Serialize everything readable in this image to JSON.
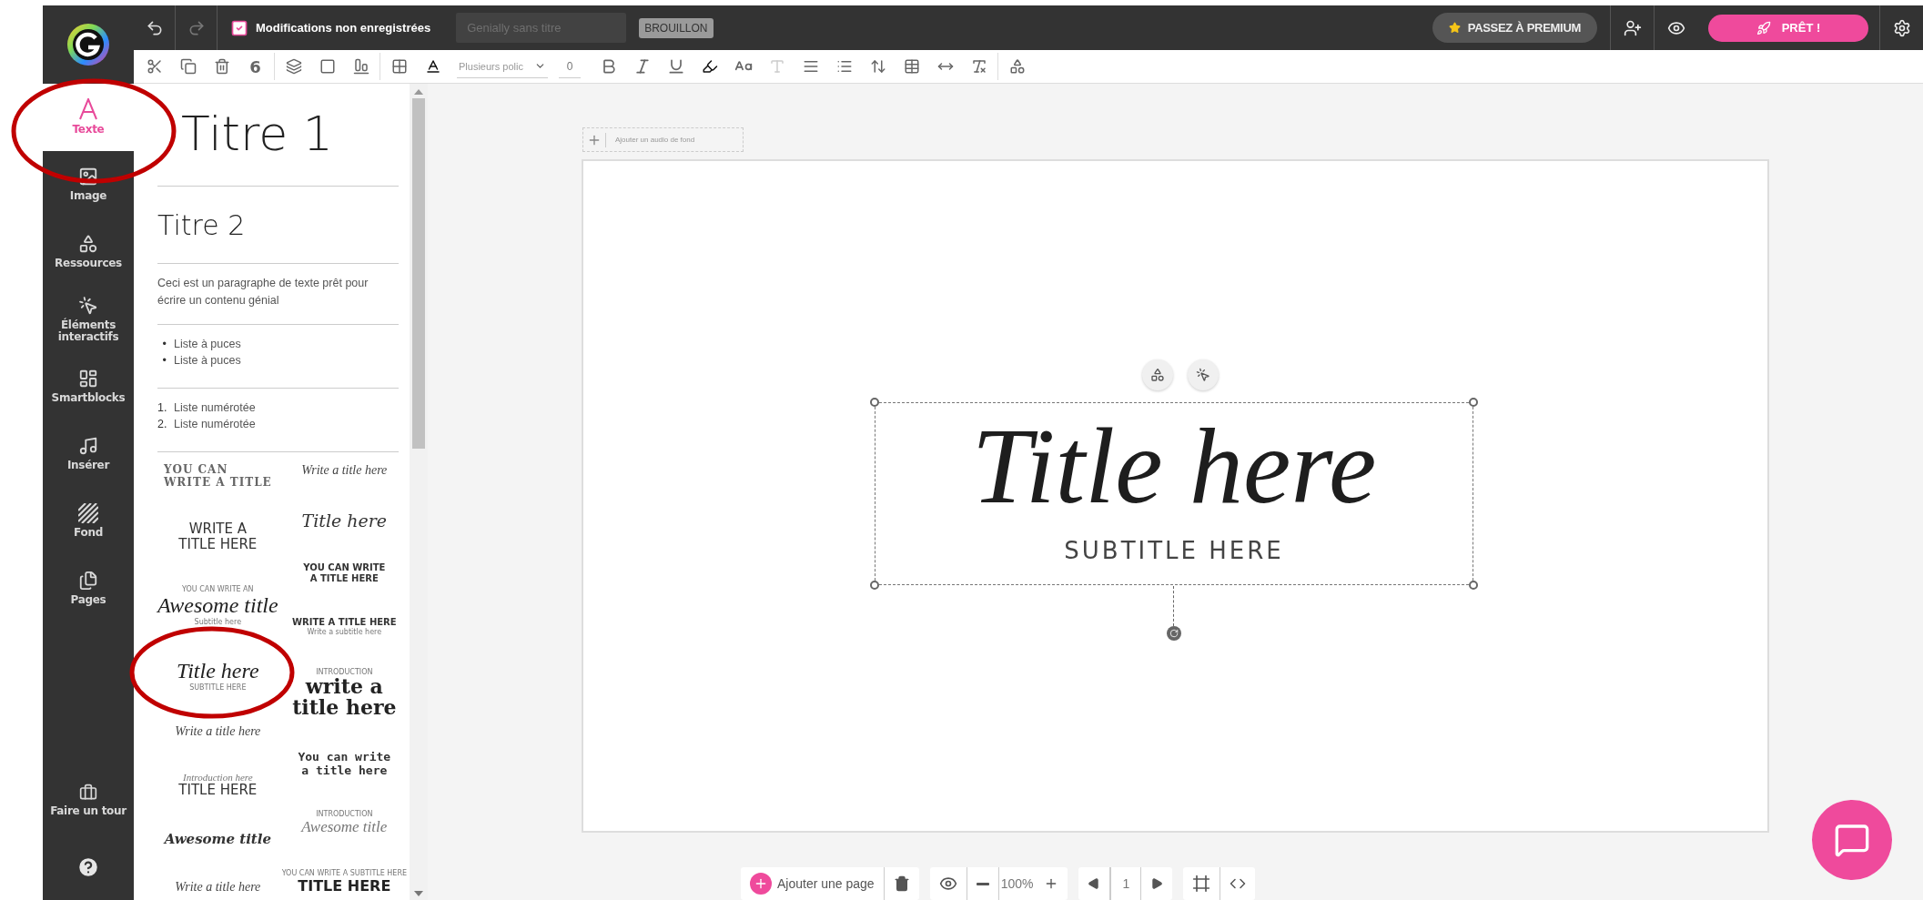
{
  "top_bar": {
    "save_status": "Modifications non enregistrées",
    "title_field": {
      "placeholder": "Genially sans titre"
    },
    "status_badge": "BROUILLON",
    "premium_button": "PASSEZ À PREMIUM",
    "ready_button": "PRÊT !"
  },
  "format_toolbar": {
    "tool_glyph": "6",
    "font_field": {
      "value": "Plusieurs polic"
    },
    "size_field": {
      "value": "0"
    }
  },
  "sidebar": {
    "items": [
      {
        "label": "Texte",
        "selected": true
      },
      {
        "label": "Image",
        "selected": false
      },
      {
        "label": "Ressources",
        "selected": false
      },
      {
        "label": "Éléments interactifs",
        "selected": false
      },
      {
        "label": "Smartblocks",
        "selected": false
      },
      {
        "label": "Insérer",
        "selected": false
      },
      {
        "label": "Fond",
        "selected": false
      },
      {
        "label": "Pages",
        "selected": false
      }
    ],
    "tour_button": "Faire un tour"
  },
  "text_panel": {
    "heading_1": "Titre 1",
    "heading_2": "Titre 2",
    "paragraph": "Ceci est un paragraphe de texte prêt pour écrire un contenu génial",
    "bullet_list": [
      {
        "marker": "•",
        "text": "Liste à puces"
      },
      {
        "marker": "•",
        "text": "Liste à puces"
      }
    ],
    "numbered_list": [
      {
        "marker": "1.",
        "text": "Liste numérotée"
      },
      {
        "marker": "2.",
        "text": "Liste numérotée"
      }
    ],
    "templates": {
      "column_1": [
        {
          "lines": [
            {
              "text": "YOU CAN",
              "kind": "serif-caps"
            },
            {
              "text": "WRITE A TITLE",
              "kind": "serif-caps"
            }
          ]
        },
        {
          "lines": [
            {
              "text": "WRITE A",
              "kind": "sans-caps"
            },
            {
              "text": "TITLE HERE",
              "kind": "sans-caps"
            }
          ]
        },
        {
          "lines": [
            {
              "text": "YOU CAN WRITE AN",
              "kind": "tiny"
            },
            {
              "text": "Awesome title",
              "kind": "script"
            },
            {
              "text": "Subtitle here",
              "kind": "tiny"
            }
          ]
        },
        {
          "lines": [
            {
              "text": "Title here",
              "kind": "script"
            },
            {
              "text": "SUBTITLE HERE",
              "kind": "tiny"
            }
          ]
        },
        {
          "lines": [
            {
              "text": "Write a title here",
              "kind": "script-small"
            }
          ]
        },
        {
          "lines": [
            {
              "text": "Introduction here",
              "kind": "serif-italic-small"
            },
            {
              "text": "TITLE HERE",
              "kind": "sans-caps"
            }
          ]
        },
        {
          "lines": [
            {
              "text": "Awesome title",
              "kind": "gothic"
            }
          ]
        },
        {
          "lines": [
            {
              "text": "Write a title here",
              "kind": "script-small"
            }
          ]
        }
      ],
      "column_2": [
        {
          "lines": [
            {
              "text": "Write a title here",
              "kind": "script-small"
            }
          ]
        },
        {
          "lines": [
            {
              "text": "Title here",
              "kind": "serif-italic"
            }
          ]
        },
        {
          "lines": [
            {
              "text": "YOU CAN WRITE",
              "kind": "heavy-caps"
            },
            {
              "text": "A TITLE HERE",
              "kind": "heavy-caps"
            }
          ]
        },
        {
          "lines": [
            {
              "text": "WRITE A TITLE HERE",
              "kind": "heavy-caps"
            },
            {
              "text": "Write a subtitle here",
              "kind": "tiny"
            }
          ]
        },
        {
          "lines": [
            {
              "text": "INTRODUCTION",
              "kind": "tiny"
            },
            {
              "text": "write a",
              "kind": "serif-display"
            },
            {
              "text": "title here",
              "kind": "serif-display"
            }
          ]
        },
        {
          "lines": [
            {
              "text": "You can write",
              "kind": "mono"
            },
            {
              "text": "a title here",
              "kind": "mono"
            }
          ]
        },
        {
          "lines": [
            {
              "text": "INTRODUCTION",
              "kind": "tiny"
            },
            {
              "text": "Awesome title",
              "kind": "serif-italic-light"
            }
          ]
        },
        {
          "lines": [
            {
              "text": "YOU CAN WRITE A SUBTITLE HERE",
              "kind": "tiny"
            },
            {
              "text": "TITLE HERE",
              "kind": "big-caps"
            }
          ]
        }
      ]
    }
  },
  "canvas": {
    "audio_button": "Ajouter un audio de fond",
    "title": "Title here",
    "subtitle": "SUBTITLE HERE"
  },
  "bottom_bar": {
    "add_page_button": "Ajouter une page",
    "zoom": "100%",
    "page_number": "1"
  }
}
